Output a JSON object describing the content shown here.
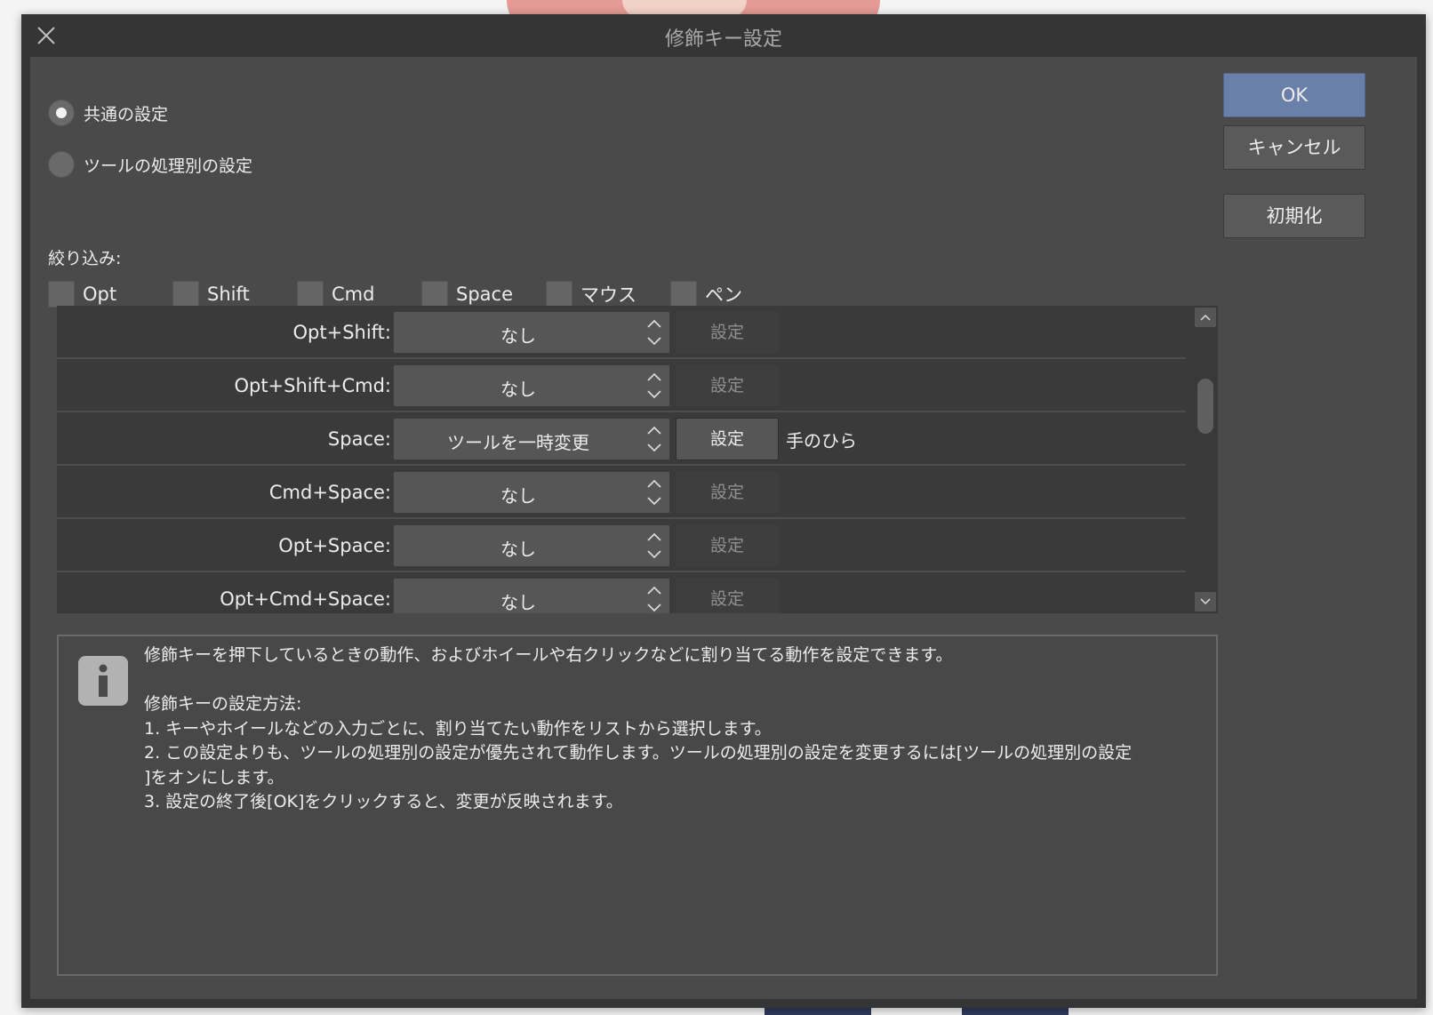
{
  "window": {
    "title": "修飾キー設定"
  },
  "mode": {
    "options": [
      {
        "label": "共通の設定",
        "checked": true
      },
      {
        "label": "ツールの処理別の設定",
        "checked": false
      }
    ]
  },
  "filter": {
    "label": "絞り込み:",
    "options": [
      {
        "label": "Opt",
        "checked": false
      },
      {
        "label": "Shift",
        "checked": false
      },
      {
        "label": "Cmd",
        "checked": false
      },
      {
        "label": "Space",
        "checked": false
      },
      {
        "label": "マウス",
        "checked": false
      },
      {
        "label": "ペン",
        "checked": false
      }
    ]
  },
  "rows": [
    {
      "key": "Opt+Shift:",
      "action": "なし",
      "set_label": "設定",
      "set_enabled": false,
      "tool": ""
    },
    {
      "key": "Opt+Shift+Cmd:",
      "action": "なし",
      "set_label": "設定",
      "set_enabled": false,
      "tool": ""
    },
    {
      "key": "Space:",
      "action": "ツールを一時変更",
      "set_label": "設定",
      "set_enabled": true,
      "tool": "手のひら"
    },
    {
      "key": "Cmd+Space:",
      "action": "なし",
      "set_label": "設定",
      "set_enabled": false,
      "tool": ""
    },
    {
      "key": "Opt+Space:",
      "action": "なし",
      "set_label": "設定",
      "set_enabled": false,
      "tool": ""
    },
    {
      "key": "Opt+Cmd+Space:",
      "action": "なし",
      "set_label": "設定",
      "set_enabled": false,
      "tool": ""
    }
  ],
  "info": {
    "text": "修飾キーを押下しているときの動作、およびホイールや右クリックなどに割り当てる動作を設定できます。\n\n修飾キーの設定方法:\n1. キーやホイールなどの入力ごとに、割り当てたい動作をリストから選択します。\n2. この設定よりも、ツールの処理別の設定が優先されて動作します。ツールの処理別の設定を変更するには[ツールの処理別の設定\n]をオンにします。\n3. 設定の終了後[OK]をクリックすると、変更が反映されます。"
  },
  "buttons": {
    "ok": "OK",
    "cancel": "キャンセル",
    "reset": "初期化"
  },
  "colors": {
    "accent": "#6a80a8",
    "dialog_bg": "#4a4a4a"
  }
}
